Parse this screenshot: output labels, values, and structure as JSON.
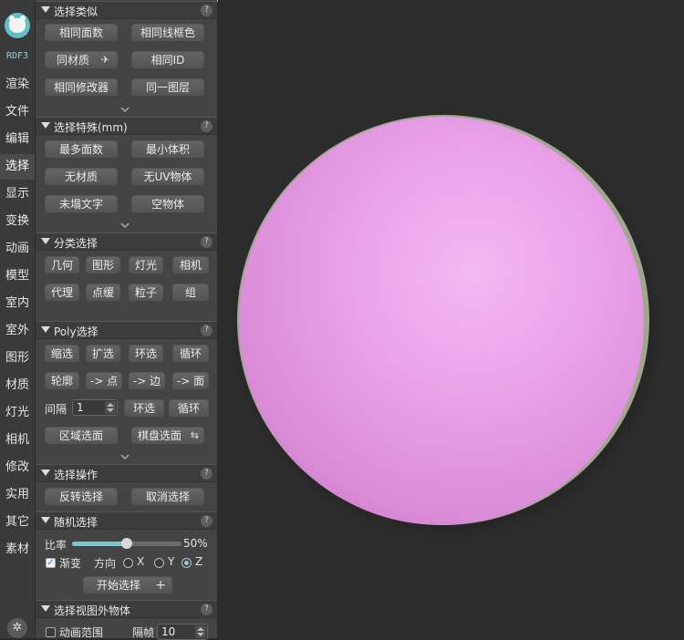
{
  "nav": {
    "brand": "RDF3",
    "items": [
      "渲染",
      "文件",
      "编辑",
      "选择",
      "显示",
      "变换",
      "动画",
      "模型",
      "室内",
      "室外",
      "图形",
      "材质",
      "灯光",
      "相机",
      "修改",
      "实用",
      "其它",
      "素材"
    ],
    "active": "选择"
  },
  "sections": {
    "select_similar": {
      "title": "选择类似",
      "buttons": [
        "相同面数",
        "相同线框色",
        "同材质",
        "相同ID",
        "相同修改器",
        "同一图层"
      ],
      "material_icon": "✈"
    },
    "select_special": {
      "title": "选择特殊(mm)",
      "buttons": [
        "最多面数",
        "最小体积",
        "无材质",
        "无UV物体",
        "未塌文字",
        "空物体"
      ]
    },
    "category_select": {
      "title": "分类选择",
      "buttons": [
        "几何",
        "图形",
        "灯光",
        "相机",
        "代理",
        "点缓",
        "粒子",
        "组"
      ]
    },
    "poly_select": {
      "title": "Poly选择",
      "buttons": [
        "缩选",
        "扩选",
        "环选",
        "循环",
        "轮廓",
        "-> 点",
        "-> 边",
        "-> 面"
      ],
      "interval_label": "间隔",
      "interval_value": "1",
      "ring_label": "环选",
      "loop_label": "循环",
      "region_label": "区域选面",
      "checker_label": "棋盘选面",
      "checker_icon": "⇆"
    },
    "select_ops": {
      "title": "选择操作",
      "buttons": [
        "反转选择",
        "取消选择"
      ]
    },
    "random_select": {
      "title": "随机选择",
      "ratio_label": "比率",
      "ratio_value": 0.5,
      "ratio_text": "50%",
      "gradient_label": "渐变",
      "gradient_checked": true,
      "direction_label": "方向",
      "axes": [
        "X",
        "Y",
        "Z"
      ],
      "selected_axis": "Z",
      "start_label": "开始选择",
      "start_icon": "+"
    },
    "outside_view": {
      "title": "选择视图外物体",
      "anim_range_label": "动画范围",
      "anim_range_checked": false,
      "frame_step_label": "隔帧",
      "frame_step_value": "10"
    }
  },
  "help_glyph": "?",
  "colors": {
    "accent": "#7fc6cc",
    "sphere": "#e79be6",
    "viewport_bg": "#2c2c2c",
    "panel_bg": "#444444"
  }
}
